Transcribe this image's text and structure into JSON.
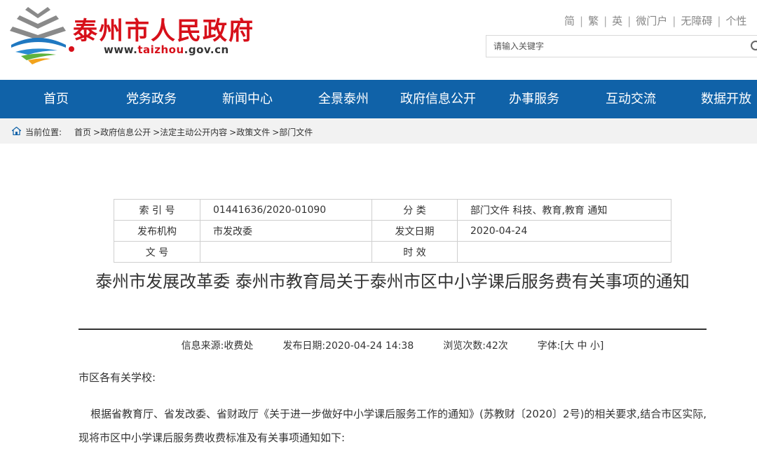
{
  "header": {
    "site_title": "泰州市人民政府",
    "url_prefix": "www.",
    "url_highlight": "taizhou",
    "url_suffix": ".gov.cn",
    "top_links": [
      "简",
      "繁",
      "英",
      "微门户",
      "无障碍",
      "个性"
    ],
    "search": {
      "placeholder": "请输入关键字"
    }
  },
  "nav": {
    "items": [
      "首页",
      "党务政务",
      "新闻中心",
      "全景泰州",
      "政府信息公开",
      "办事服务",
      "互动交流",
      "数据开放"
    ]
  },
  "breadcrumb": {
    "label": "当前位置:",
    "items": [
      "首页",
      ">政府信息公开",
      ">法定主动公开内容",
      ">政策文件",
      ">部门文件"
    ]
  },
  "meta": {
    "rows": [
      {
        "k1": "索 引 号",
        "v1": "01441636/2020-01090",
        "k2": "分 类",
        "v2": "部门文件 科技、教育,教育 通知"
      },
      {
        "k1": "发布机构",
        "v1": "市发改委",
        "k2": "发文日期",
        "v2": "2020-04-24"
      },
      {
        "k1": "文 号",
        "v1": "",
        "k2": "时 效",
        "v2": ""
      }
    ]
  },
  "article": {
    "title": "泰州市发展改革委 泰州市教育局关于泰州市区中小学课后服务费有关事项的通知",
    "info": {
      "source_label": "信息来源:",
      "source": "收费处",
      "date_label": "发布日期:",
      "date": "2020-04-24 14:38",
      "views_label": "浏览次数:",
      "views": "42次",
      "font_label": "字体:",
      "font_open": "[",
      "font_large": "大",
      "font_medium": "中",
      "font_small": "小",
      "font_close": "]"
    },
    "paragraphs": [
      "市区各有关学校:",
      "根据省教育厅、省发改委、省财政厅《关于进一步做好中小学课后服务工作的通知》(苏教财〔2020〕2号)的相关要求,结合市区实际,现将市区中小学课后服务费收费标准及有关事项通知如下:"
    ]
  },
  "colors": {
    "brand_red": "#d7101a",
    "nav_blue": "#1062a8",
    "breadcrumb_bg": "#f2f2f2"
  },
  "icons": {
    "logo": "taizhou-gov-logo",
    "breadcrumb": "home-icon",
    "search": "search-icon"
  }
}
